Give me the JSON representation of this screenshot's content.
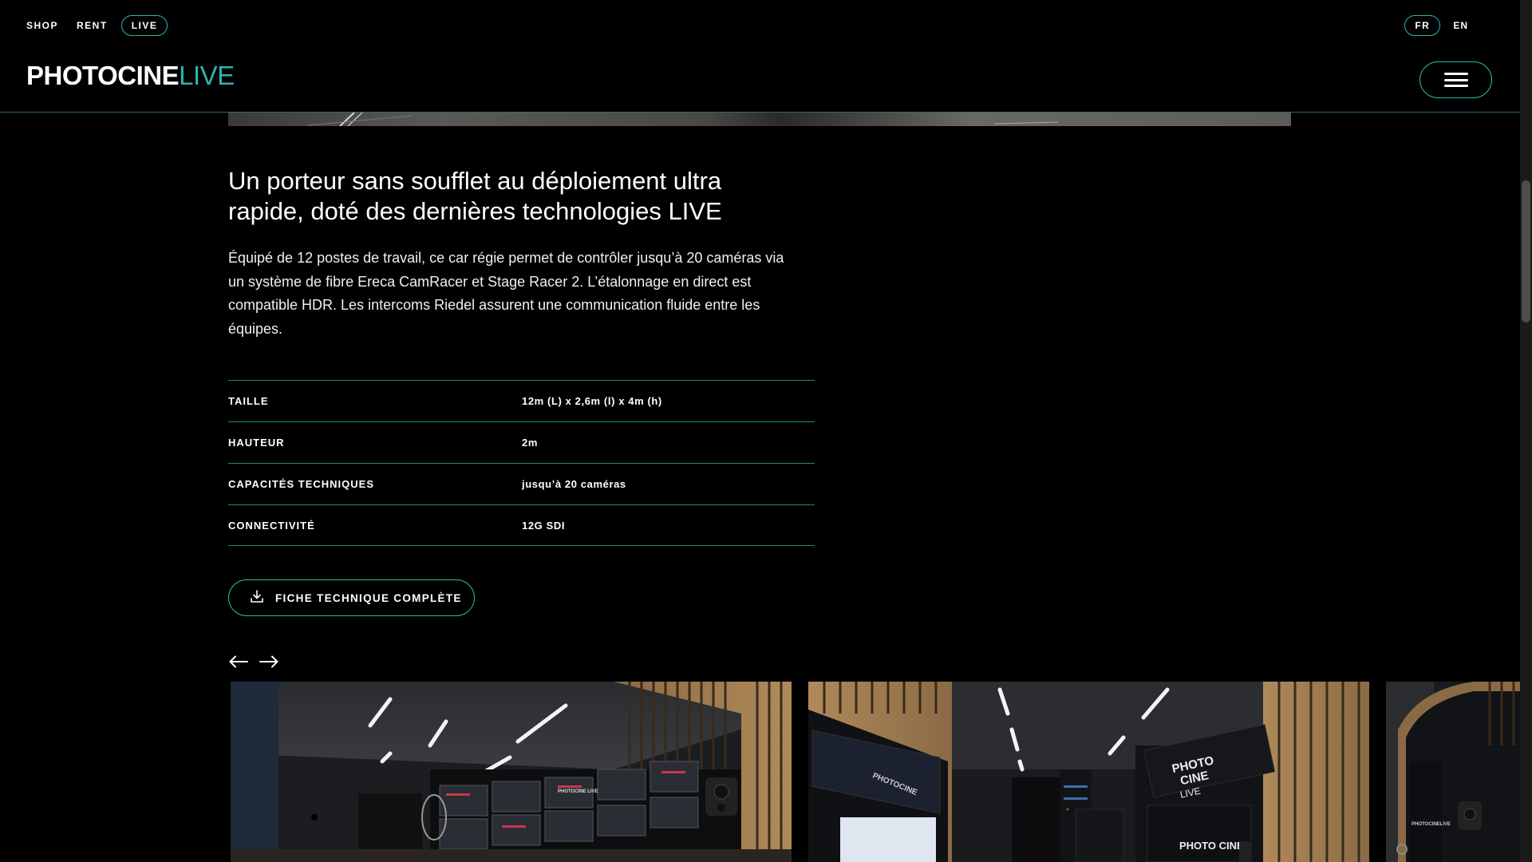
{
  "topnav": {
    "shop": "SHOP",
    "rent": "RENT",
    "live": "LIVE"
  },
  "langs": {
    "fr": "FR",
    "en": "EN"
  },
  "brand": {
    "part1": "PHOTOCINE",
    "part2": "LIVE"
  },
  "content": {
    "headline": "Un porteur sans soufflet au déploiement ultra rapide, doté des dernières technologies LIVE",
    "description": "Équipé de 12 postes de travail, ce car régie permet de contrôler jusqu’à 20 caméras via un système de fibre Ereca CamRacer et Stage Racer 2. L’étalonnage en direct est compatible HDR. Les intercoms Riedel assurent une communication fluide entre les équipes."
  },
  "specs": [
    {
      "label": "TAILLE",
      "value": "12m (L) x 2,6m (l) x 4m (h)"
    },
    {
      "label": "HAUTEUR",
      "value": "2m"
    },
    {
      "label": "CAPACITÉS TECHNIQUES",
      "value": "jusqu’à 20 caméras"
    },
    {
      "label": "CONNECTIVITÉ",
      "value": "12G SDI"
    }
  ],
  "download_button": {
    "label": "FICHE TECHNIQUE COMPLÈTE",
    "icon": "download-icon"
  },
  "carousel": {
    "prev_icon": "arrow-left-icon",
    "next_icon": "arrow-right-icon",
    "slide_texts": {
      "photo": "PHOTO",
      "cine": "CINE",
      "live": "LIVE",
      "photocine_live": "PHOTOCINE LIVE",
      "photocine": "PHOTOCINE",
      "photo_cine": "PHOTO CINE",
      "photocinelive": "PHOTOCINELIVE"
    }
  },
  "colors": {
    "accent": "#2bb5b0",
    "background": "#000000",
    "divider": "#1f8784"
  }
}
